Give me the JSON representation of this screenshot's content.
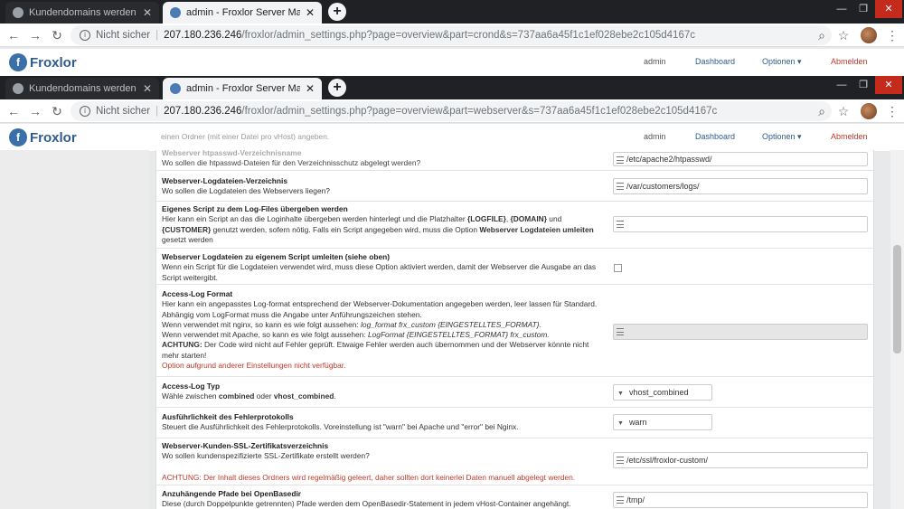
{
  "window1": {
    "tabs": [
      {
        "title": "Kundendomains werden nicht au",
        "active": false
      },
      {
        "title": "admin - Froxlor Server Managem",
        "active": true
      }
    ],
    "url": {
      "insecure_label": "Nicht sicher",
      "host": "207.180.236.246",
      "path": "/froxlor/admin_settings.php?page=overview&part=crond&s=737aa6a45f1c1ef028ebe2c105d4167c"
    }
  },
  "window2": {
    "tabs": [
      {
        "title": "Kundendomains werden nicht au",
        "active": false
      },
      {
        "title": "admin - Froxlor Server Managem",
        "active": true
      }
    ],
    "url": {
      "insecure_label": "Nicht sicher",
      "host": "207.180.236.246",
      "path": "/froxlor/admin_settings.php?page=overview&part=webserver&s=737aa6a45f1c1ef028ebe2c105d4167c"
    }
  },
  "header": {
    "logo": "Froxlor",
    "user": "admin",
    "dashboard": "Dashboard",
    "options": "Optionen",
    "options_caret": "▾",
    "logout": "Abmelden"
  },
  "ghost": {
    "line1": "einen Ordner (mit einer Datei pro vHost) angeben.",
    "title": "Webserver htpasswd-Verzeichnisname",
    "desc": "Wo sollen die htpasswd-Dateien für den Verzeichnisschutz abgelegt werden?",
    "value": "/etc/apache2/htpasswd/"
  },
  "settings": [
    {
      "title": "Webserver-Logdateien-Verzeichnis",
      "desc": "Wo sollen die Logdateien des Webservers liegen?",
      "value": "/var/customers/logs/"
    },
    {
      "title": "Eigenes Script zu dem Log-Files übergeben werden",
      "desc_a": "Hier kann ein Script an das die Loginhalte übergeben werden hinterlegt und die Platzhalter",
      "ph1": "{LOGFILE}",
      "c1": ",",
      "ph2": "{DOMAIN}",
      "c2": "und",
      "ph3": "{CUSTOMER}",
      "desc_b": "genutzt werden, sofern nötig. Falls ein Script angegeben wird, muss die Option",
      "opt": "Webserver Logdateien umleiten",
      "desc_c": "gesetzt werden",
      "value": ""
    },
    {
      "title": "Webserver Logdateien zu eigenem Script umleiten (siehe oben)",
      "desc": "Wenn ein Script für die Logdateien verwendet wird, muss diese Option aktiviert werden, damit der Webserver die Ausgabe an das Script weitergibt."
    },
    {
      "title": "Access-Log Format",
      "l1": "Hier kann ein angepasstes Log-format entsprechend der Webserver-Dokumentation angegeben werden, leer lassen für Standard. Abhängig vom LogFormat muss die Angabe unter Anführungszeichen stehen.",
      "l2a": "Wenn verwendet mit nginx, so kann es wie folgt aussehen:",
      "l2b": "log_format frx_custom {EINGESTELLTES_FORMAT}.",
      "l3a": "Wenn verwendet mit Apache, so kann es wie folgt aussehen:",
      "l3b": "LogFormat {EINGESTELLTES_FORMAT} frx_custom.",
      "l4a": "ACHTUNG:",
      "l4b": "Der Code wird nicht auf Fehler geprüft. Etwaige Fehler werden auch übernommen und der Webserver könnte nicht mehr starten!",
      "warn": "Option aufgrund anderer Einstellungen nicht verfügbar."
    },
    {
      "title": "Access-Log Typ",
      "d_a": "Wähle zwischen",
      "d_b": "combined",
      "d_c": "oder",
      "d_d": "vhost_combined",
      "d_e": ".",
      "value": "vhost_combined"
    },
    {
      "title": "Ausführlichkeit des Fehlerprotokolls",
      "desc": "Steuert die Ausführlichkeit des Fehlerprotokolls. Voreinstellung ist \"warn\" bei Apache und \"error\" bei Nginx.",
      "value": "warn"
    },
    {
      "title": "Webserver-Kunden-SSL-Zertifikatsverzeichnis",
      "desc": "Wo sollen kundenspezifizierte SSL-Zertifikate erstellt werden?",
      "warn": "ACHTUNG: Der Inhalt dieses Ordners wird regelmäßig geleert, daher sollten dort keinerlei Daten manuell abgelegt werden.",
      "value": "/etc/ssl/froxlor-custom/"
    },
    {
      "title": "Anzuhängende Pfade bei OpenBasedir",
      "desc": "Diese (durch Doppelpunkte getrennten) Pfade werden dem OpenBasedir-Statement in jedem vHost-Container angehängt.",
      "value": "/tmp/"
    }
  ]
}
